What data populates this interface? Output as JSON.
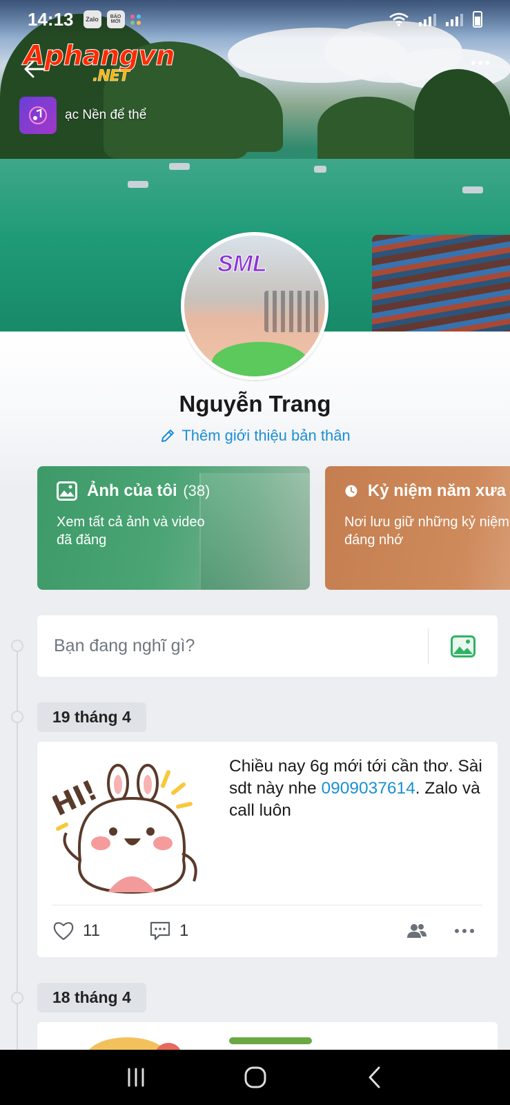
{
  "status_bar": {
    "time": "14:13",
    "app_icons": [
      "Zalo",
      "BÁO MỚI"
    ]
  },
  "watermark": {
    "main": "Aphangvn",
    "suffix": ".NET"
  },
  "music": {
    "label": "ạc Nền để thể"
  },
  "profile": {
    "name": "Nguyễn Trang",
    "add_bio": "Thêm giới thiệu bản thân",
    "avatar_sticker": "SML"
  },
  "albums": [
    {
      "title": "Ảnh của tôi",
      "count": "(38)",
      "description": "Xem tất cả ảnh và video đã đăng",
      "color": "#42a06c"
    },
    {
      "title": "Kỷ niệm năm xưa",
      "description": "Nơi lưu giữ những kỷ niệm đáng nhớ",
      "color": "#c98455"
    }
  ],
  "composer": {
    "placeholder": "Bạn đang nghĩ gì?"
  },
  "timeline": [
    {
      "date": "19 tháng 4",
      "text_before": "Chiều nay 6g mới tới cần thơ. Sài sdt này nhe ",
      "link": "0909037614",
      "text_after": ". Zalo và call luôn",
      "likes": "11",
      "comments": "1",
      "sticker_text": "HI!"
    },
    {
      "date": "18 tháng 4"
    }
  ],
  "colors": {
    "accent": "#1b8fd3",
    "background": "#eceef1",
    "card": "#ffffff"
  },
  "icons": [
    "back-arrow-icon",
    "more-dots-icon",
    "music-note-icon",
    "pencil-icon",
    "image-icon",
    "clock-icon",
    "photo-icon",
    "heart-icon",
    "comment-icon",
    "friends-icon",
    "more-icon",
    "recent-apps-icon",
    "home-icon",
    "back-nav-icon"
  ]
}
